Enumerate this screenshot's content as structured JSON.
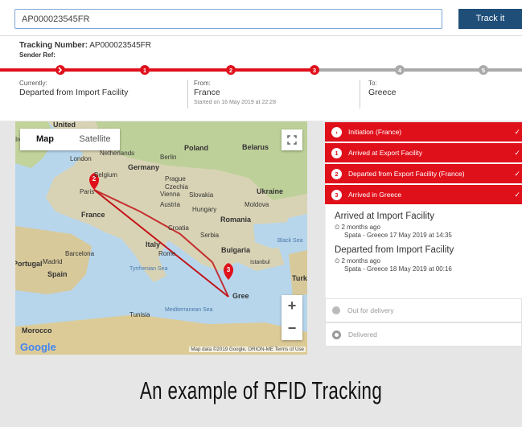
{
  "search": {
    "value": "AP000023545FR"
  },
  "track_button": "Track it",
  "tracking": {
    "number_label": "Tracking Number:",
    "number": "AP000023545FR",
    "sender_ref": "Sender Ref:"
  },
  "progress": {
    "steps": [
      "1",
      "2",
      "3",
      "4",
      "5"
    ],
    "completed": 3
  },
  "status": {
    "currently_label": "Currently:",
    "currently": "Departed from Import Facility",
    "from_label": "From:",
    "from": "France",
    "started": "Started on 16 May 2019 at 22:28",
    "to_label": "To:",
    "to": "Greece"
  },
  "map": {
    "tabs": [
      "Map",
      "Satellite"
    ],
    "labels": [
      "United",
      "Ireland",
      "London",
      "Netherlands",
      "Belgium",
      "Germany",
      "Berlin",
      "Poland",
      "Belarus",
      "Paris",
      "Prague",
      "Czechia",
      "Slovakia",
      "Ukraine",
      "Vienna",
      "Austria",
      "Hungary",
      "Moldova",
      "France",
      "Romania",
      "Croatia",
      "Serbia",
      "Bulgaria",
      "Italy",
      "Rome",
      "Barcelona",
      "Portugal",
      "Madrid",
      "Spain",
      "Black Sea",
      "Tyrrhenian Sea",
      "Istanbul",
      "Turke",
      "Tunisia",
      "Mediterranean Sea",
      "Morocco",
      "Gree"
    ],
    "markers": [
      "2",
      "3"
    ],
    "zoom_in": "+",
    "zoom_out": "−",
    "logo": "Google",
    "attribution": "Map data ©2019 Google, ORION-ME   Terms of Use"
  },
  "steps": [
    {
      "label": "Initiation (France)",
      "num": "›"
    },
    {
      "label": "Arrived at Export Facility",
      "num": "1"
    },
    {
      "label": "Departed from Export Facility (France)",
      "num": "2"
    },
    {
      "label": "Arrived in Greece",
      "num": "3"
    }
  ],
  "events": [
    {
      "title": "Arrived at Import Facility",
      "meta": "2 months ago",
      "location": "Spata - Greece 17 May 2019 at 14:35"
    },
    {
      "title": "Departed from Import Facility",
      "meta": "2 months ago",
      "location": "Spata - Greece 18 May 2019 at 00:16"
    }
  ],
  "pending": [
    "Out for delivery",
    "Delivered"
  ],
  "caption": "An example of RFID Tracking",
  "colors": {
    "accent": "#e0101b",
    "button": "#1f4e79",
    "inactive": "#aaaaaa"
  }
}
